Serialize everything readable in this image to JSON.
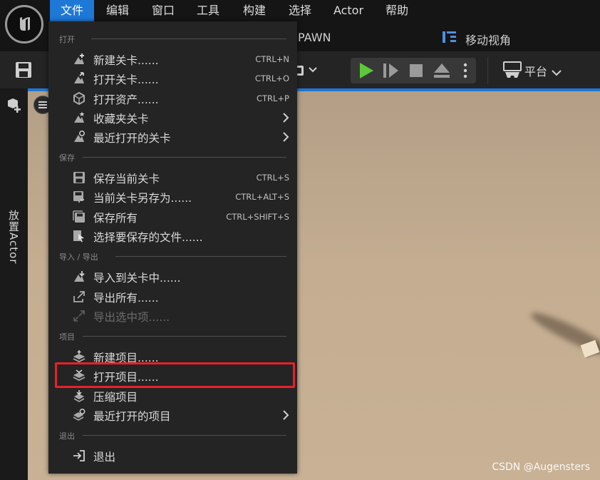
{
  "menubar": {
    "items": [
      {
        "label": "文件"
      },
      {
        "label": "编辑"
      },
      {
        "label": "窗口"
      },
      {
        "label": "工具"
      },
      {
        "label": "构建"
      },
      {
        "label": "选择"
      },
      {
        "label": "Actor"
      },
      {
        "label": "帮助"
      }
    ]
  },
  "tabs": {
    "pawn": "PAWN",
    "move_view": "移动视角"
  },
  "toolbar": {
    "platform": "平台"
  },
  "leftstrip": {
    "place_actor": "放置Actor"
  },
  "file_menu": {
    "sections": {
      "open": "打开",
      "save": "保存",
      "import_export": "导入 / 导出",
      "project": "项目",
      "exit": "退出"
    },
    "items": {
      "new_level": {
        "label": "新建关卡......",
        "shortcut": "CTRL+N"
      },
      "open_level": {
        "label": "打开关卡......",
        "shortcut": "CTRL+O"
      },
      "open_asset": {
        "label": "打开资产......",
        "shortcut": "CTRL+P"
      },
      "favorite_levels": {
        "label": "收藏夹关卡"
      },
      "recent_levels": {
        "label": "最近打开的关卡"
      },
      "save_current": {
        "label": "保存当前关卡",
        "shortcut": "CTRL+S"
      },
      "save_as": {
        "label": "当前关卡另存为......",
        "shortcut": "CTRL+ALT+S"
      },
      "save_all": {
        "label": "保存所有",
        "shortcut": "CTRL+SHIFT+S"
      },
      "choose_files": {
        "label": "选择要保存的文件......"
      },
      "import_level": {
        "label": "导入到关卡中......"
      },
      "export_all": {
        "label": "导出所有......"
      },
      "export_selected": {
        "label": "导出选中项......"
      },
      "new_project": {
        "label": "新建项目......"
      },
      "open_project": {
        "label": "打开项目......"
      },
      "zip_project": {
        "label": "压缩项目"
      },
      "recent_projects": {
        "label": "最近打开的项目"
      },
      "exit": {
        "label": "退出"
      }
    }
  },
  "watermark": "CSDN @Augensters",
  "colors": {
    "accent": "#1e78d6",
    "highlight": "#e8202a",
    "play_green": "#5cc83a"
  }
}
